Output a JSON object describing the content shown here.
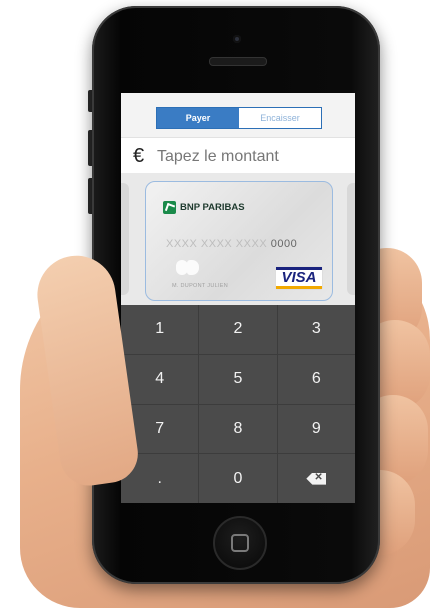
{
  "segmented_control": {
    "pay_label": "Payer",
    "collect_label": "Encaisser"
  },
  "amount": {
    "currency_symbol": "€",
    "placeholder": "Tapez le montant"
  },
  "card": {
    "bank_name": "BNP PARIBAS",
    "number_masked": "XXXX XXXX XXXX",
    "number_last4": "0000",
    "holder_name": "M. DUPONT JULIEN",
    "network": "VISA",
    "network_icon": "visa-logo",
    "chip_icon": "cb-logo",
    "bank_logo_icon": "bnp-paribas-logo"
  },
  "keypad": {
    "k1": "1",
    "k2": "2",
    "k3": "3",
    "k4": "4",
    "k5": "5",
    "k6": "6",
    "k7": "7",
    "k8": "8",
    "k9": "9",
    "dot": ".",
    "k0": "0",
    "backspace_icon": "backspace-icon"
  },
  "colors": {
    "accent_blue": "#3a7cc4",
    "keypad_bg": "#4b4b4b",
    "bank_green": "#1a8a4a"
  }
}
